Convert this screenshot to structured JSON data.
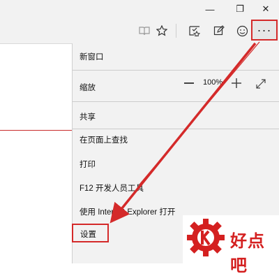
{
  "window": {
    "minimize_glyph": "—",
    "restore_glyph": "❐",
    "close_glyph": "✕"
  },
  "toolbar": {
    "icons": [
      "reading-view-icon",
      "favorite-star-icon",
      "hub-icon",
      "web-note-icon",
      "feedback-smile-icon"
    ],
    "more_glyph": "···"
  },
  "menu": {
    "new_window": "新窗口",
    "zoom_label": "缩放",
    "zoom_value": "100%",
    "share": "共享",
    "find_on_page": "在页面上查找",
    "print": "打印",
    "dev_tools": "F12 开发人员工具",
    "open_with_ie": "使用 Internet Explorer 打开",
    "settings": "设置"
  },
  "watermark": {
    "text": "好点吧"
  },
  "colors": {
    "highlight": "#d42a2a",
    "menu_bg": "#f2f2f2",
    "watermark": "#d42020"
  }
}
